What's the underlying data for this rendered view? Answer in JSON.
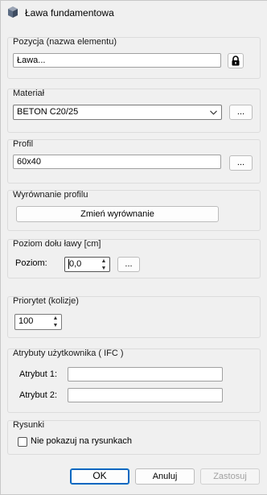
{
  "window": {
    "title": "Ława fundamentowa"
  },
  "position": {
    "group_label": "Pozycja (nazwa elementu)",
    "value": "Ława..."
  },
  "material": {
    "group_label": "Materiał",
    "selected": "BETON C20/25",
    "browse_label": "..."
  },
  "profile": {
    "group_label": "Profil",
    "value": "60x40",
    "browse_label": "..."
  },
  "alignment": {
    "group_label": "Wyrównanie profilu",
    "button_label": "Zmień wyrównanie"
  },
  "bottom_level": {
    "group_label": "Poziom dołu ławy [cm]",
    "field_label": "Poziom:",
    "value": "0,0",
    "browse_label": "..."
  },
  "priority": {
    "group_label": "Priorytet (kolizje)",
    "value": "100"
  },
  "attributes": {
    "group_label": "Atrybuty użytkownika ( IFC )",
    "attr1_label": "Atrybut 1:",
    "attr1_value": "",
    "attr2_label": "Atrybut 2:",
    "attr2_value": ""
  },
  "drawings": {
    "group_label": "Rysunki",
    "hide_label": "Nie pokazuj na rysunkach",
    "hide_checked": false
  },
  "footer": {
    "ok_label": "OK",
    "cancel_label": "Anuluj",
    "apply_label": "Zastosuj"
  },
  "colors": {
    "accent": "#0067c0",
    "disabled_text": "#a0a0a0"
  }
}
